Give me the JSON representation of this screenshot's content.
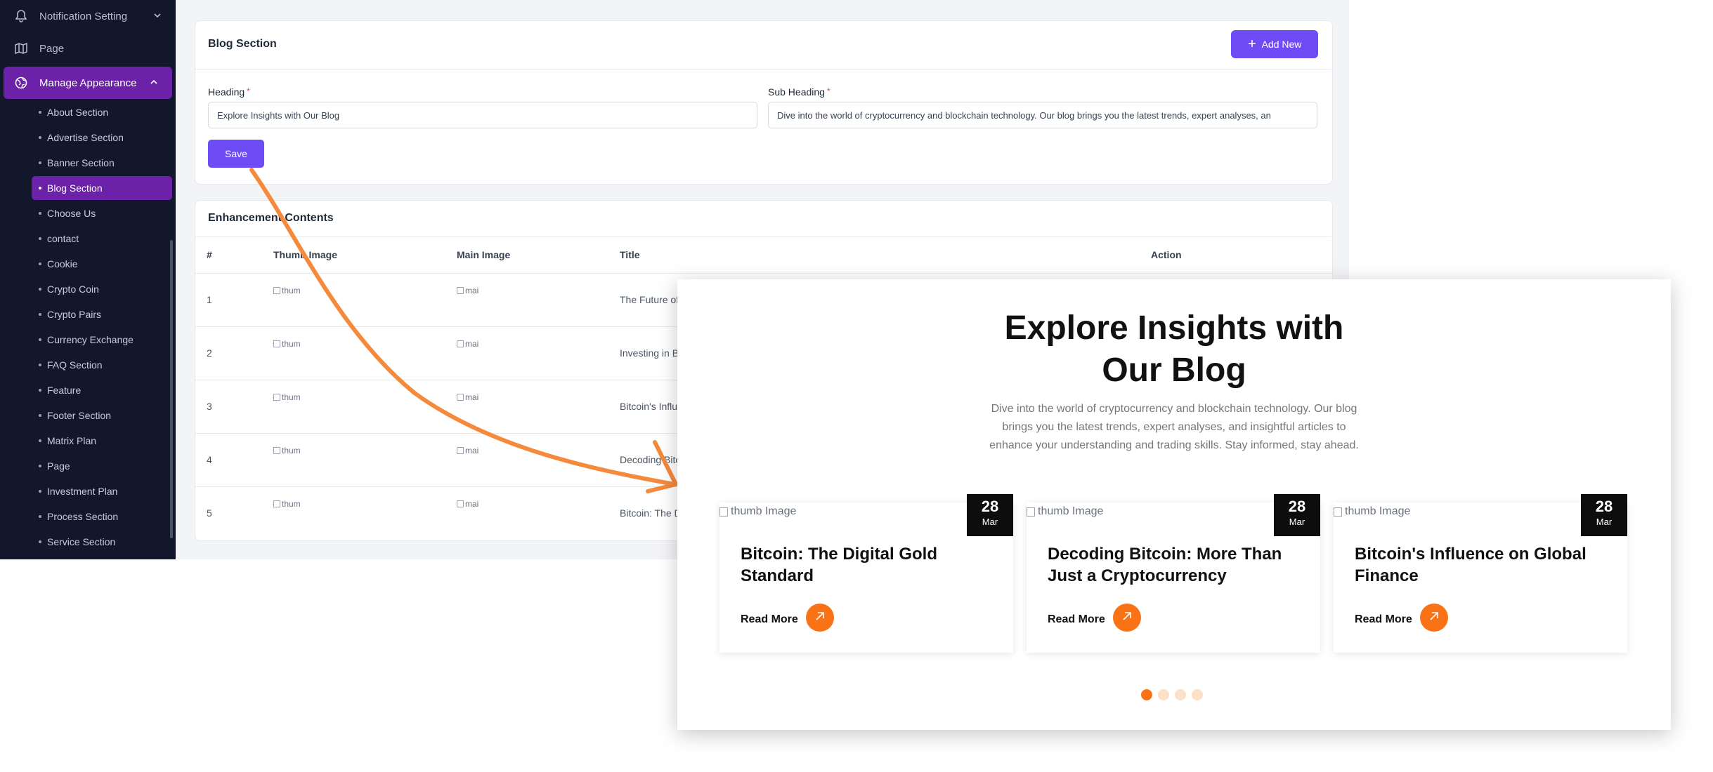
{
  "sidebar": {
    "top_items": [
      {
        "label": "Notification Setting",
        "icon": "bell-icon"
      },
      {
        "label": "Page",
        "icon": "map-icon"
      },
      {
        "label": "Manage Appearance",
        "icon": "globe-icon"
      }
    ],
    "sub_items": [
      "About Section",
      "Advertise Section",
      "Banner Section",
      "Blog Section",
      "Choose Us",
      "contact",
      "Cookie",
      "Crypto Coin",
      "Crypto Pairs",
      "Currency Exchange",
      "FAQ Section",
      "Feature",
      "Footer Section",
      "Matrix Plan",
      "Page",
      "Investment Plan",
      "Process Section",
      "Service Section"
    ],
    "active_sub": "Blog Section"
  },
  "blog_section": {
    "title": "Blog Section",
    "add_new_label": "Add New",
    "heading_label": "Heading",
    "heading_value": "Explore Insights with Our Blog",
    "subheading_label": "Sub Heading",
    "subheading_value": "Dive into the world of cryptocurrency and blockchain technology. Our blog brings you the latest trends, expert analyses, an",
    "save_label": "Save",
    "required_mark": "*"
  },
  "enhancement": {
    "title": "Enhancement Contents",
    "columns": [
      "#",
      "Thumb Image",
      "Main Image",
      "Title",
      "Action"
    ],
    "rows": [
      {
        "num": "1",
        "thumb": "thum",
        "main": "mai",
        "title": "The Future of"
      },
      {
        "num": "2",
        "thumb": "thum",
        "main": "mai",
        "title": "Investing in B"
      },
      {
        "num": "3",
        "thumb": "thum",
        "main": "mai",
        "title": "Bitcoin's Influ"
      },
      {
        "num": "4",
        "thumb": "thum",
        "main": "mai",
        "title": "Decoding Bitc"
      },
      {
        "num": "5",
        "thumb": "thum",
        "main": "mai",
        "title": "Bitcoin: The D"
      }
    ]
  },
  "preview": {
    "heading_line1": "Explore Insights with",
    "heading_line2": "Our Blog",
    "subheading": "Dive into the world of cryptocurrency and blockchain technology. Our blog brings you the latest trends, expert analyses, and insightful articles to enhance your understanding and trading skills. Stay informed, stay ahead.",
    "cards": [
      {
        "thumb_alt": "thumb Image",
        "day": "28",
        "month": "Mar",
        "title": "Bitcoin: The Digital Gold Standard",
        "read_more": "Read More"
      },
      {
        "thumb_alt": "thumb Image",
        "day": "28",
        "month": "Mar",
        "title": "Decoding Bitcoin: More Than Just a Cryptocurrency",
        "read_more": "Read More"
      },
      {
        "thumb_alt": "thumb Image",
        "day": "28",
        "month": "Mar",
        "title": "Bitcoin's Influence on Global Finance",
        "read_more": "Read More"
      }
    ],
    "pager": {
      "total": 4,
      "active": 1
    }
  },
  "colors": {
    "sidebar_bg": "#12172b",
    "active_purple": "#6b21a8",
    "button_purple": "#6d4cf5",
    "accent_orange": "#f97316",
    "callout_arrow": "#f58a3c"
  }
}
